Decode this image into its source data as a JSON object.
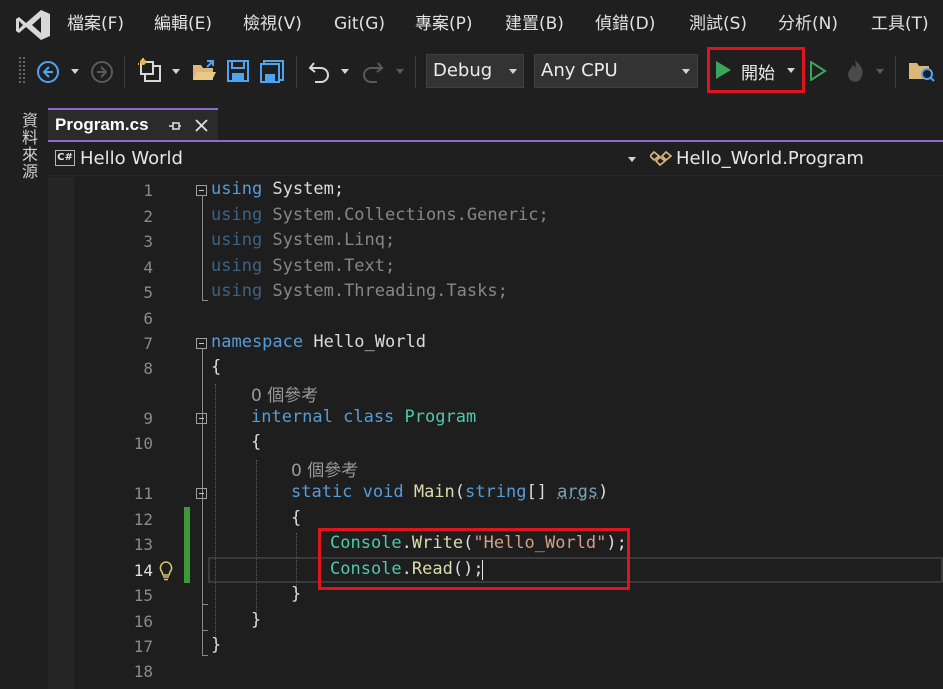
{
  "menu": {
    "items": [
      "檔案(F)",
      "編輯(E)",
      "檢視(V)",
      "Git(G)",
      "專案(P)",
      "建置(B)",
      "偵錯(D)",
      "測試(S)",
      "分析(N)",
      "工具(T)"
    ]
  },
  "toolbar": {
    "configuration": "Debug",
    "platform": "Any CPU",
    "start_label": "開始",
    "icons": [
      "back-icon",
      "forward-icon",
      "new-project-icon",
      "open-folder-icon",
      "save-icon",
      "save-all-icon",
      "undo-icon",
      "redo-icon",
      "start-icon",
      "start-without-debugging-icon",
      "hot-reload-icon",
      "solution-explorer-icon"
    ]
  },
  "side_panel": {
    "label": "資料來源"
  },
  "tab": {
    "title": "Program.cs"
  },
  "navbar": {
    "project_badge": "C#",
    "project": "Hello World",
    "class": "Hello_World.Program"
  },
  "editor": {
    "line_numbers": [
      "1",
      "2",
      "3",
      "4",
      "5",
      "6",
      "7",
      "8",
      "9",
      "10",
      "11",
      "12",
      "13",
      "14",
      "15",
      "16",
      "17",
      "18"
    ],
    "references_label": "0 個參考",
    "code": {
      "l1_kw": "using",
      "l1_rest": " System;",
      "l2_kw": "using",
      "l2_rest": " System.Collections.Generic;",
      "l3_kw": "using",
      "l3_rest": " System.Linq;",
      "l4_kw": "using",
      "l4_rest": " System.Text;",
      "l5_kw": "using",
      "l5_rest": " System.Threading.Tasks;",
      "l7_kw": "namespace",
      "l7_rest": " Hello_World",
      "brace_open": "{",
      "brace_close": "}",
      "l9_kw": "internal class",
      "l9_ty": " Program",
      "l11_kw": "static void",
      "l11_fn": " Main",
      "l11_p1": "(",
      "l11_kw2": "string",
      "l11_p2": "[] ",
      "l11_arg": "args",
      "l11_p3": ")",
      "l13_ty": "Console",
      "l13_p1": ".",
      "l13_fn": "Write",
      "l13_p2": "(",
      "l13_st": "\"Hello_World\"",
      "l13_p3": ");",
      "l14_ty": "Console",
      "l14_p1": ".",
      "l14_fn": "Read",
      "l14_p2": "();"
    }
  },
  "colors": {
    "keyword": "#569cd6",
    "type": "#4ec9b0",
    "method": "#dcdcaa",
    "string": "#d69d85",
    "highlight_box": "#e0141e",
    "tab_accent": "#8d6bd3",
    "start_green": "#3ba55c"
  }
}
